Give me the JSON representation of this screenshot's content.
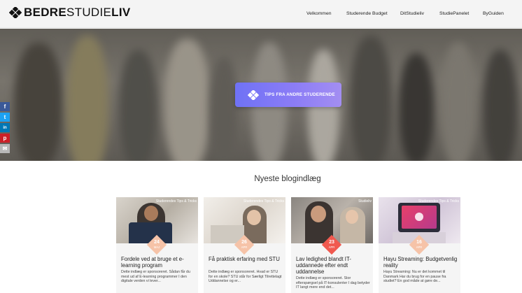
{
  "header": {
    "logo": {
      "part1": "BEDRE",
      "part2": "STUDIE",
      "part3": "LIV"
    },
    "nav": [
      "Velkommen",
      "Studerende Budget",
      "DitStudieliv",
      "StudiePanelet",
      "ByGuiden"
    ]
  },
  "hero": {
    "cta_label": "TIPS FRA ANDRE STUDERENDE"
  },
  "social": [
    "f",
    "t",
    "in",
    "p",
    "✉"
  ],
  "section": {
    "title": "Nyeste blogindlæg"
  },
  "posts": [
    {
      "tag": "Studerendes Tips & Tricks",
      "day": "24",
      "month": "MAJ",
      "title": "Fordele ved at bruge et e-learning program",
      "excerpt": "Dette indlæg er sponsoreret. Sådan får du mest ud af E-learning programmer I den digitale verden vi lever..."
    },
    {
      "tag": "Studerendes Tips & Tricks",
      "day": "26",
      "month": "APR",
      "title": "Få praktisk erfaring med STU",
      "excerpt": "Dette indlæg er sponsoreret. Hvad er STU for en skole? STU står for Særligt Tilrettelagt Uddannelse og er..."
    },
    {
      "tag": "Studieliv",
      "day": "23",
      "month": "APR",
      "title": "Lav ledighed blandt IT-uddannede efter endt uddannelse",
      "excerpt": "Dette indlæg er sponsoreret. Stor efterspørgsel på IT-konsulenter I dag betyder IT langt mere end det..."
    },
    {
      "tag": "Studerendes Tips & Tricks",
      "day": "16",
      "month": "APR",
      "title": "Hayu Streaming: Budgetvenlig reality",
      "excerpt": "Hayu Streaming: Nu er det kommet til Danmark Har du brug for en pause fra studiet? En god måde at gøre de..."
    }
  ]
}
